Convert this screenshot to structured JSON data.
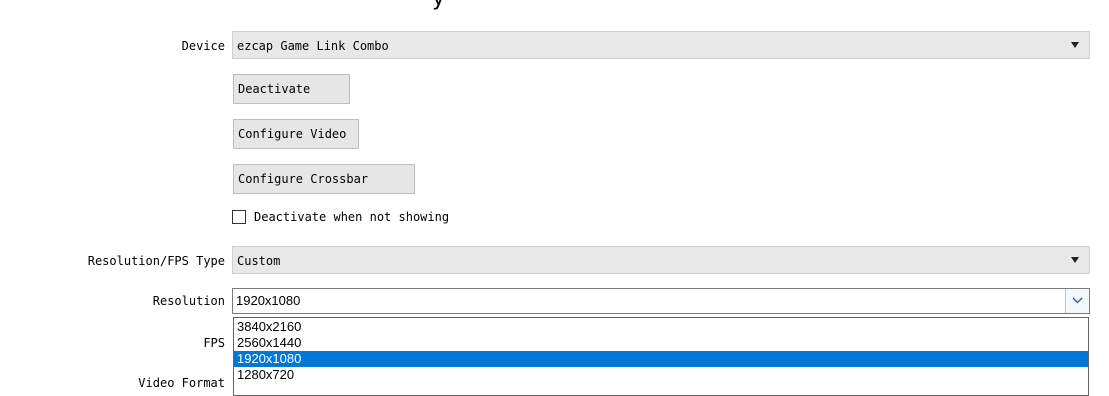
{
  "device": {
    "label": "Device",
    "value": "ezcap Game Link Combo"
  },
  "buttons": {
    "deactivate": "Deactivate",
    "configure_video": "Configure Video",
    "configure_crossbar": "Configure Crossbar"
  },
  "checkbox": {
    "label": "Deactivate when not showing",
    "checked": false
  },
  "resolution_fps_type": {
    "label": "Resolution/FPS Type",
    "value": "Custom"
  },
  "resolution": {
    "label": "Resolution",
    "value": "1920x1080",
    "options": [
      "3840x2160",
      "2560x1440",
      "1920x1080",
      "1280x720"
    ],
    "selected_index": 2
  },
  "fps": {
    "label": "FPS"
  },
  "video_format": {
    "label": "Video Format"
  },
  "colors": {
    "combo_bg": "#e8e8e8",
    "button_bg": "#e6e6e6",
    "selection": "#0078d7"
  },
  "icons": {
    "dropdown": "triangle-down-icon",
    "resolution_dropdown": "chevron-down-icon"
  }
}
